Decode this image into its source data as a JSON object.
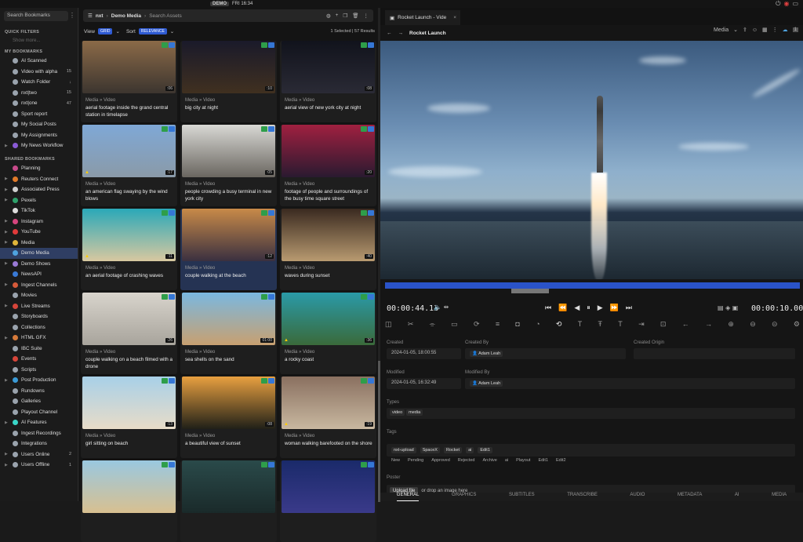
{
  "topbar": {
    "badge": "DEMO",
    "time": "FRI 16:34"
  },
  "sidebar": {
    "search_placeholder": "Search Bookmarks",
    "quick_filters_label": "QUICK FILTERS",
    "quick_hint": "Show more...",
    "my_bookmarks_label": "MY BOOKMARKS",
    "my_items": [
      {
        "label": "AI Scanned",
        "count": "",
        "color": "#9aa3ad"
      },
      {
        "label": "Video with alpha",
        "count": "15",
        "color": "#9aa3ad"
      },
      {
        "label": "Watch Folder",
        "count": "↓",
        "color": "#9aa3ad"
      },
      {
        "label": "nxt|two",
        "count": "15",
        "color": "#9aa3ad"
      },
      {
        "label": "nxt|one",
        "count": "47",
        "color": "#9aa3ad"
      },
      {
        "label": "Sport report",
        "count": "",
        "color": "#9aa3ad"
      },
      {
        "label": "My Social Posts",
        "count": "",
        "color": "#9aa3ad"
      },
      {
        "label": "My Assignments",
        "count": "",
        "color": "#9aa3ad"
      },
      {
        "label": "My News Workflow",
        "count": "",
        "color": "#8a5ad6"
      }
    ],
    "shared_label": "SHARED BOOKMARKS",
    "shared_items": [
      {
        "label": "Planning",
        "count": "",
        "color": "#c84a8a"
      },
      {
        "label": "Reuters Connect",
        "count": "",
        "color": "#e07a2a"
      },
      {
        "label": "Associated Press",
        "count": "",
        "color": "#cfcfcf"
      },
      {
        "label": "Pexels",
        "count": "",
        "color": "#2ea06a"
      },
      {
        "label": "TikTok",
        "count": "",
        "color": "#dddddd"
      },
      {
        "label": "Instagram",
        "count": "",
        "color": "#d6457e"
      },
      {
        "label": "YouTube",
        "count": "",
        "color": "#e03a3a"
      },
      {
        "label": "Media",
        "count": "",
        "color": "#e0b43a"
      },
      {
        "label": "Demo Media",
        "count": "",
        "color": "#4fa3e0"
      },
      {
        "label": "Demo Shows",
        "count": "",
        "color": "#9a7ad6"
      },
      {
        "label": "NewsAPI",
        "count": "",
        "color": "#3a7ad6"
      },
      {
        "label": "Ingest Channels",
        "count": "",
        "color": "#d65a3a"
      },
      {
        "label": "Movies",
        "count": "",
        "color": "#9aa3ad"
      },
      {
        "label": "Live Streams",
        "count": "",
        "color": "#d6453a"
      },
      {
        "label": "Storyboards",
        "count": "",
        "color": "#9aa3ad"
      },
      {
        "label": "Collections",
        "count": "",
        "color": "#9aa3ad"
      },
      {
        "label": "HTML GFX",
        "count": "",
        "color": "#d67a3a"
      },
      {
        "label": "IBC Suite",
        "count": "",
        "color": "#9aa3ad"
      },
      {
        "label": "Events",
        "count": "",
        "color": "#d6453a"
      },
      {
        "label": "Scripts",
        "count": "",
        "color": "#9aa3ad"
      },
      {
        "label": "Post Production",
        "count": "",
        "color": "#3a9ad6"
      },
      {
        "label": "Rundowns",
        "count": "",
        "color": "#9aa3ad"
      },
      {
        "label": "Galleries",
        "count": "",
        "color": "#9aa3ad"
      },
      {
        "label": "Playout Channel",
        "count": "",
        "color": "#9aa3ad"
      },
      {
        "label": "AI Features",
        "count": "",
        "color": "#3ad6c8"
      },
      {
        "label": "Ingest Recordings",
        "count": "",
        "color": "#9aa3ad"
      },
      {
        "label": "Integrations",
        "count": "",
        "color": "#9aa3ad"
      },
      {
        "label": "Users Online",
        "count": "2",
        "color": "#9aa3ad"
      },
      {
        "label": "Users Offline",
        "count": "1",
        "color": "#9aa3ad"
      }
    ]
  },
  "browser": {
    "crumb1": "nxt",
    "crumb2": "Demo Media",
    "search_placeholder": "Search Assets",
    "view_label": "View",
    "view_value": "GRID",
    "sort_label": "Sort",
    "sort_value": "RELEVANCE",
    "results": "1 Selected | 57 Results",
    "tiles": [
      {
        "type": "Media » Video",
        "title": "aerial footage inside the grand central station in timelapse",
        "dur": ":06",
        "warn": false,
        "g1": "#8b6a48",
        "g2": "#3c352f"
      },
      {
        "type": "Media » Video",
        "title": "big city at night",
        "dur": ":10",
        "warn": false,
        "g1": "#1a1a2a",
        "g2": "#403020"
      },
      {
        "type": "Media » Video",
        "title": "aerial view of new york city at night",
        "dur": ":08",
        "warn": false,
        "g1": "#11131c",
        "g2": "#2a2a35"
      },
      {
        "type": "Media » Video",
        "title": "an american flag swaying by the wind blows",
        "dur": ":17",
        "warn": true,
        "g1": "#7fa8d6",
        "g2": "#8a9aa8"
      },
      {
        "type": "Media » Video",
        "title": "people crowding a busy terminal in new york city",
        "dur": ":05",
        "warn": false,
        "g1": "#d8d8d4",
        "g2": "#6a6660"
      },
      {
        "type": "Media » Video",
        "title": "footage of people and surroundings of the busy time square street",
        "dur": ":20",
        "warn": false,
        "g1": "#a02040",
        "g2": "#2a1a30"
      },
      {
        "type": "Media » Video",
        "title": "an aerial footage of crashing waves",
        "dur": ":11",
        "warn": true,
        "g1": "#2aa8b8",
        "g2": "#d8c8a0"
      },
      {
        "type": "Media » Video",
        "title": "couple walking at the beach",
        "dur": ":12",
        "warn": false,
        "g1": "#c88a48",
        "g2": "#3a3040"
      },
      {
        "type": "Media » Video",
        "title": "waves during sunset",
        "dur": ":40",
        "warn": false,
        "g1": "#3a2a20",
        "g2": "#b89a70"
      },
      {
        "type": "Media » Video",
        "title": "couple walking on a beach filmed with a drone",
        "dur": ":26",
        "warn": false,
        "g1": "#d8d4cc",
        "g2": "#a8a49c"
      },
      {
        "type": "Media » Video",
        "title": "sea shells on the sand",
        "dur": "01:00",
        "warn": false,
        "g1": "#7ab8e0",
        "g2": "#c8a070"
      },
      {
        "type": "Media » Video",
        "title": "a rocky coast",
        "dur": ":36",
        "warn": true,
        "g1": "#2a9aa8",
        "g2": "#3a6a3a"
      },
      {
        "type": "Media » Video",
        "title": "girl sitting on beach",
        "dur": ":13",
        "warn": false,
        "g1": "#a8d0e8",
        "g2": "#e8dcc8"
      },
      {
        "type": "Media » Video",
        "title": "a beautiful view of sunset",
        "dur": ":08",
        "warn": false,
        "g1": "#e8a040",
        "g2": "#202018"
      },
      {
        "type": "Media » Video",
        "title": "woman walking barefooted on the shore",
        "dur": ":19",
        "warn": true,
        "g1": "#8a7060",
        "g2": "#c8b8a0"
      },
      {
        "type": "",
        "title": "",
        "dur": "",
        "warn": false,
        "g1": "#9ac8e0",
        "g2": "#d8c090"
      },
      {
        "type": "",
        "title": "",
        "dur": "",
        "warn": false,
        "g1": "#2a4a4a",
        "g2": "#1a2a2a"
      },
      {
        "type": "",
        "title": "",
        "dur": "",
        "warn": false,
        "g1": "#1a2a6a",
        "g2": "#3a3a8a"
      }
    ]
  },
  "player": {
    "tab_title": "Rocket Launch - Vide",
    "asset_title": "Rocket Launch",
    "media_select": "Media",
    "timecode_current": "00:00:44.13",
    "timecode_total": "00:00:10.00"
  },
  "metadata": {
    "created_label": "Created",
    "created_value": "2024-01-05, 18:00:55",
    "created_by_label": "Created By",
    "created_by_value": "Adam Leah",
    "created_origin_label": "Created Origin",
    "modified_label": "Modified",
    "modified_value": "2024-01-05, 16:32:49",
    "modified_by_label": "Modified By",
    "modified_by_value": "Adam Leah",
    "types_label": "Types",
    "types": [
      "video",
      "media"
    ],
    "tags_label": "Tags",
    "tags": [
      "nxt-upload",
      "SpaceX",
      "Rocket",
      "ai",
      "Edit1"
    ],
    "status_items": [
      "New",
      "Pending",
      "Approved",
      "Rejected",
      "Archive",
      "ai",
      "Playout",
      "Edit1",
      "Edit2"
    ],
    "poster_label": "Poster",
    "upload_btn": "Upload file",
    "upload_hint": "or drop an image here"
  },
  "bottom_tabs": [
    "GENERAL",
    "GRAPHICS",
    "SUBTITLES",
    "TRANSCRIBE",
    "AUDIO",
    "METADATA",
    "AI",
    "MEDIA"
  ]
}
